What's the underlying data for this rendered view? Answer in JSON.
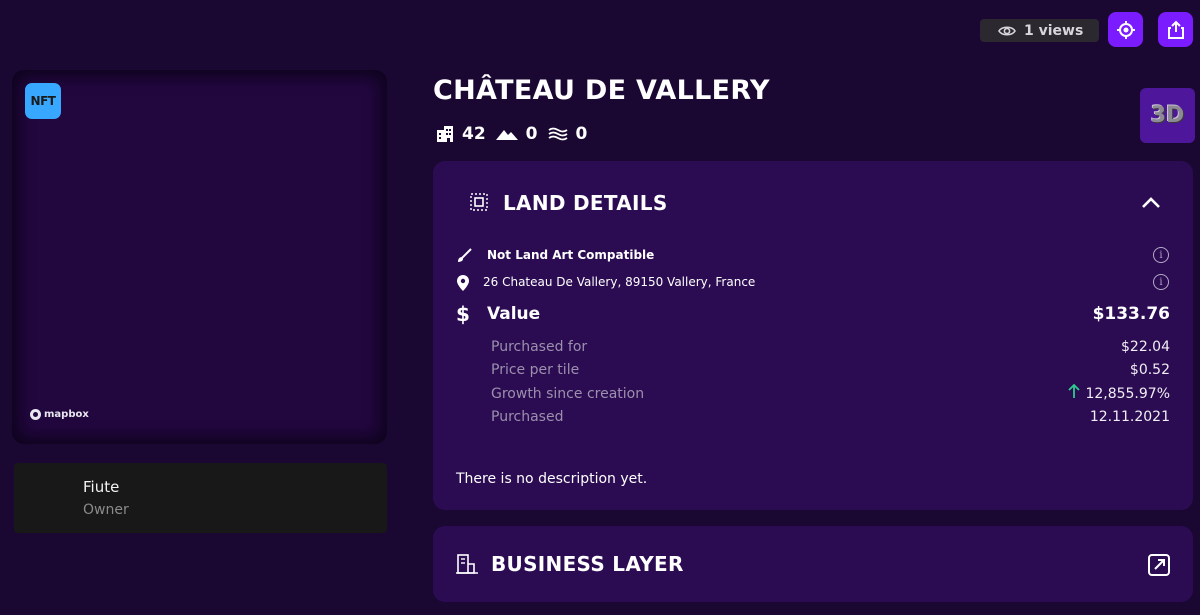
{
  "header": {
    "views_label": "1 views",
    "icons": {
      "views": "eye-icon",
      "locate": "target-icon",
      "share": "share-icon"
    }
  },
  "map": {
    "badge_label": "NFT",
    "attribution": "mapbox"
  },
  "owner": {
    "name": "Fiute",
    "role": "Owner"
  },
  "property": {
    "title": "CHÂTEAU DE VALLERY",
    "stats": [
      {
        "icon": "buildings-icon",
        "value": "42"
      },
      {
        "icon": "mountain-icon",
        "value": "0"
      },
      {
        "icon": "water-icon",
        "value": "0"
      }
    ],
    "view_3d_label": "3D"
  },
  "land_details": {
    "title": "LAND DETAILS",
    "land_art": "Not Land Art Compatible",
    "address": "26 Chateau De Vallery, 89150 Vallery, France",
    "value_label": "Value",
    "value_amount": "$133.76",
    "rows": [
      {
        "label": "Purchased for",
        "value": "$22.04"
      },
      {
        "label": "Price per tile",
        "value": "$0.52"
      },
      {
        "label": "Growth since creation",
        "value": "12,855.97%"
      },
      {
        "label": "Purchased",
        "value": "12.11.2021"
      }
    ],
    "description": "There is no description yet."
  },
  "business_layer": {
    "title": "BUSINESS LAYER"
  },
  "colors": {
    "background": "#1a0833",
    "panel": "#2b0b52",
    "accent": "#7a1cff",
    "growth_arrow": "#2ecc8f",
    "nft_badge": "#38a7ff"
  }
}
